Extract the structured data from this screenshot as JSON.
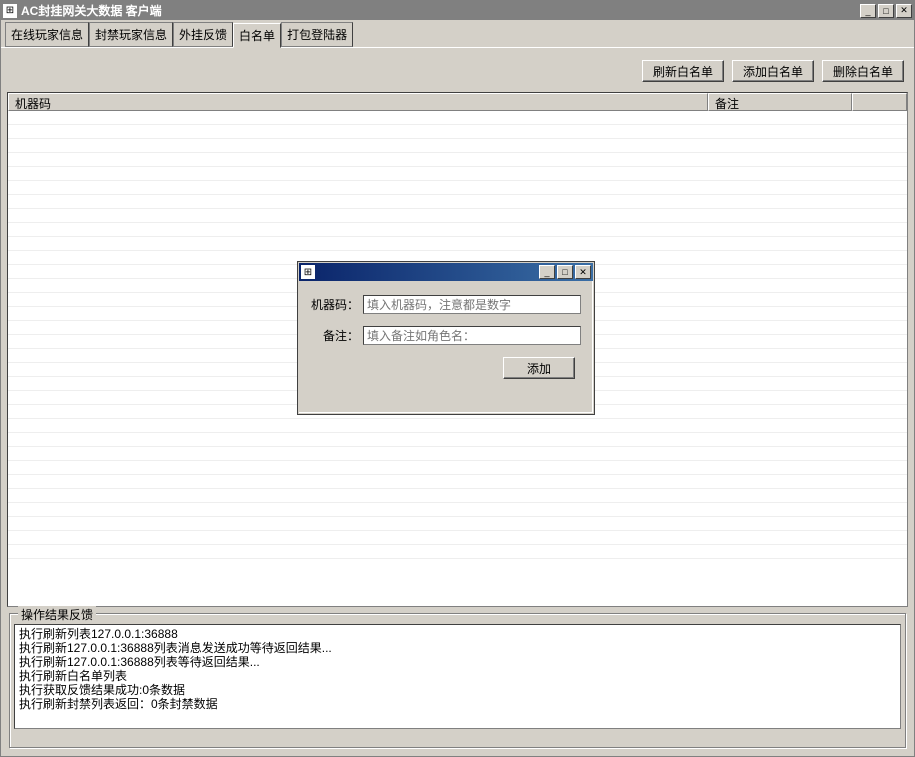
{
  "window": {
    "title": "AC封挂网关大数据 客户端"
  },
  "tabs": [
    {
      "label": "在线玩家信息"
    },
    {
      "label": "封禁玩家信息"
    },
    {
      "label": "外挂反馈"
    },
    {
      "label": "白名单"
    },
    {
      "label": "打包登陆器"
    }
  ],
  "toolbar": {
    "refresh": "刷新白名单",
    "add": "添加白名单",
    "delete": "删除白名单"
  },
  "table": {
    "col_machine": "机器码",
    "col_remark": "备注",
    "rows": []
  },
  "dialog": {
    "title": "",
    "field_machine_label": "机器码：",
    "field_machine_placeholder": "填入机器码，注意都是数字",
    "field_remark_label": "备注：",
    "field_remark_placeholder": "填入备注如角色名：",
    "add_button": "添加"
  },
  "feedback": {
    "group_label": "操作结果反馈",
    "lines": [
      "执行刷新列表127.0.0.1:36888",
      "执行刷新127.0.0.1:36888列表消息发送成功等待返回结果...",
      "执行刷新127.0.0.1:36888列表等待返回结果...",
      "执行刷新白名单列表",
      "执行获取反馈结果成功:0条数据",
      "执行刷新封禁列表返回：0条封禁数据"
    ]
  }
}
